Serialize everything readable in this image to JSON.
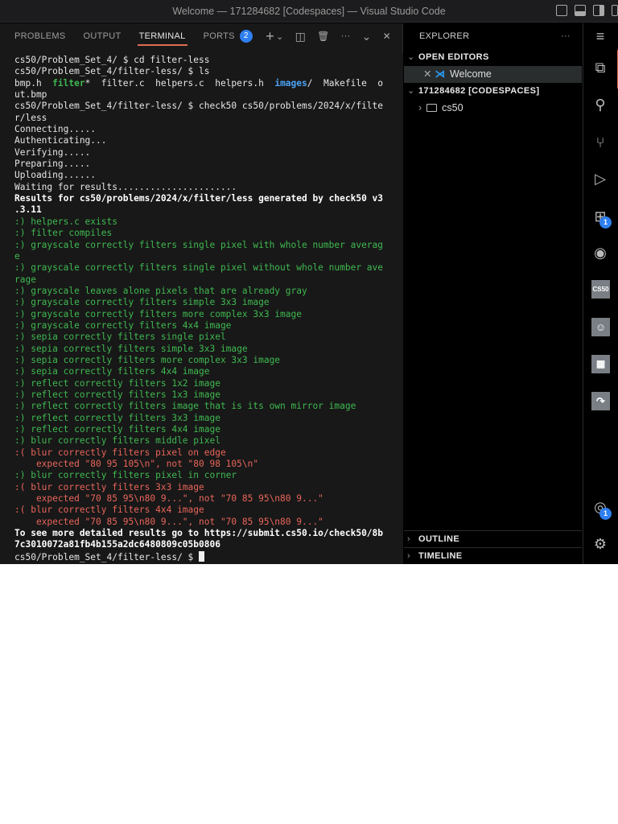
{
  "window": {
    "title": "Welcome — 171284682 [Codespaces] — Visual Studio Code"
  },
  "panel": {
    "tabs": [
      {
        "label": "PROBLEMS"
      },
      {
        "label": "OUTPUT"
      },
      {
        "label": "TERMINAL",
        "active": true
      },
      {
        "label": "PORTS",
        "badge": "2"
      }
    ],
    "actions": {
      "add": "+",
      "dropdown": "⌄",
      "split": "◫",
      "trash": "🗑",
      "more": "···",
      "collapse": "⌄",
      "close": "✕"
    }
  },
  "terminal": {
    "lines": [
      [
        [
          "",
          "cs50/Problem_Set_4/ $ cd filter-less"
        ]
      ],
      [
        [
          "",
          "cs50/Problem_Set_4/filter-less/ $ ls"
        ]
      ],
      [
        [
          "",
          "bmp.h  "
        ],
        [
          "fg",
          "filter"
        ],
        [
          "",
          "*  filter.c  helpers.c  helpers.h  "
        ],
        [
          "b",
          "images"
        ],
        [
          "",
          "/  Makefile  o"
        ]
      ],
      [
        [
          "",
          "ut.bmp"
        ]
      ],
      [
        [
          "",
          "cs50/Problem_Set_4/filter-less/ $ check50 cs50/problems/2024/x/filte"
        ]
      ],
      [
        [
          "",
          "r/less"
        ]
      ],
      [
        [
          "",
          "Connecting....."
        ]
      ],
      [
        [
          "",
          "Authenticating..."
        ]
      ],
      [
        [
          "",
          "Verifying....."
        ]
      ],
      [
        [
          "",
          "Preparing....."
        ]
      ],
      [
        [
          "",
          "Uploading......"
        ]
      ],
      [
        [
          "",
          "Waiting for results......................"
        ]
      ],
      [
        [
          "w",
          "Results for cs50/problems/2024/x/filter/less generated by check50 v3"
        ]
      ],
      [
        [
          "w",
          ".3.11"
        ]
      ],
      [
        [
          "g",
          ":) helpers.c exists"
        ]
      ],
      [
        [
          "g",
          ":) filter compiles"
        ]
      ],
      [
        [
          "g",
          ":) grayscale correctly filters single pixel with whole number averag"
        ]
      ],
      [
        [
          "g",
          "e"
        ]
      ],
      [
        [
          "g",
          ":) grayscale correctly filters single pixel without whole number ave"
        ]
      ],
      [
        [
          "g",
          "rage"
        ]
      ],
      [
        [
          "g",
          ":) grayscale leaves alone pixels that are already gray"
        ]
      ],
      [
        [
          "g",
          ":) grayscale correctly filters simple 3x3 image"
        ]
      ],
      [
        [
          "g",
          ":) grayscale correctly filters more complex 3x3 image"
        ]
      ],
      [
        [
          "g",
          ":) grayscale correctly filters 4x4 image"
        ]
      ],
      [
        [
          "g",
          ":) sepia correctly filters single pixel"
        ]
      ],
      [
        [
          "g",
          ":) sepia correctly filters simple 3x3 image"
        ]
      ],
      [
        [
          "g",
          ":) sepia correctly filters more complex 3x3 image"
        ]
      ],
      [
        [
          "g",
          ":) sepia correctly filters 4x4 image"
        ]
      ],
      [
        [
          "g",
          ":) reflect correctly filters 1x2 image"
        ]
      ],
      [
        [
          "g",
          ":) reflect correctly filters 1x3 image"
        ]
      ],
      [
        [
          "g",
          ":) reflect correctly filters image that is its own mirror image"
        ]
      ],
      [
        [
          "g",
          ":) reflect correctly filters 3x3 image"
        ]
      ],
      [
        [
          "g",
          ":) reflect correctly filters 4x4 image"
        ]
      ],
      [
        [
          "g",
          ":) blur correctly filters middle pixel"
        ]
      ],
      [
        [
          "r",
          ":( blur correctly filters pixel on edge"
        ]
      ],
      [
        [
          "r",
          "    expected \"80 95 105\\n\", not \"80 98 105\\n\""
        ]
      ],
      [
        [
          "g",
          ":) blur correctly filters pixel in corner"
        ]
      ],
      [
        [
          "r",
          ":( blur correctly filters 3x3 image"
        ]
      ],
      [
        [
          "r",
          "    expected \"70 85 95\\n80 9...\", not \"70 85 95\\n80 9...\""
        ]
      ],
      [
        [
          "r",
          ":( blur correctly filters 4x4 image"
        ]
      ],
      [
        [
          "r",
          "    expected \"70 85 95\\n80 9...\", not \"70 85 95\\n80 9...\""
        ]
      ],
      [
        [
          "w",
          "To see more detailed results go to https://submit.cs50.io/check50/8b"
        ]
      ],
      [
        [
          "w",
          "7c3010072a81fb4b155a2dc6480809c05b0806"
        ]
      ],
      [
        [
          "",
          "cs50/Problem_Set_4/filter-less/ $ "
        ],
        [
          "cursor",
          ""
        ]
      ]
    ]
  },
  "explorer": {
    "title": "EXPLORER",
    "more": "···",
    "open_editors": "OPEN EDITORS",
    "open_file": "Welcome",
    "workspace": "171284682 [CODESPACES]",
    "folder": "cs50",
    "outline": "OUTLINE",
    "timeline": "TIMELINE"
  },
  "activity": {
    "extensions_badge": "1",
    "accounts_badge": "1",
    "cs50_label": "CS50"
  },
  "colors": {
    "accent": "#e06c52",
    "badge": "#2f7ff0",
    "pass": "#3fb950",
    "fail": "#e9655a"
  }
}
